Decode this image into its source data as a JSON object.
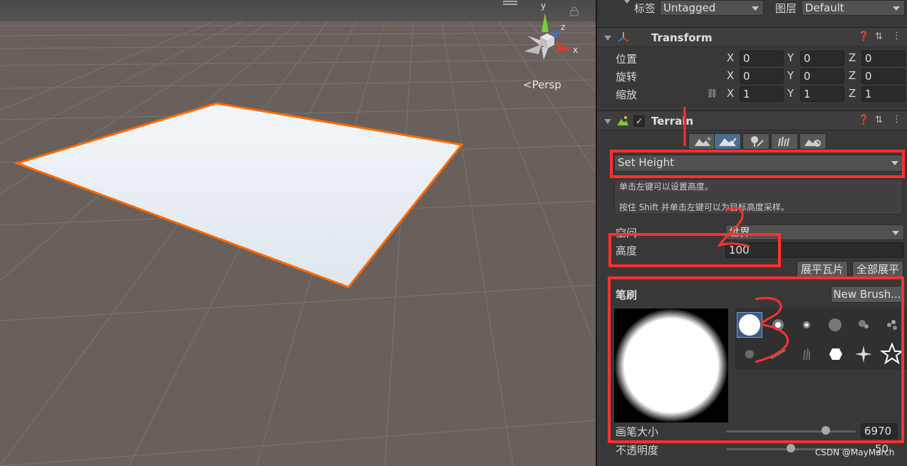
{
  "scene": {
    "view_mode": "<Persp",
    "gizmo_axes": {
      "x": "x",
      "y": "y",
      "z": "z"
    },
    "colors": {
      "ground": "#6a605b",
      "grid": "#807775",
      "sky": "#4a4a4a",
      "plane": "#e8eef4",
      "outline": "#ff6a00"
    }
  },
  "inspector": {
    "tag_label": "标签",
    "tag_value": "Untagged",
    "layer_label": "图层",
    "layer_value": "Default",
    "transform": {
      "title": "Transform",
      "rows": [
        {
          "label": "位置",
          "x": "0",
          "y": "0",
          "z": "0"
        },
        {
          "label": "旋转",
          "x": "0",
          "y": "0",
          "z": "0"
        },
        {
          "label": "缩放",
          "x": "1",
          "y": "1",
          "z": "1"
        }
      ],
      "axis_x": "X",
      "axis_y": "Y",
      "axis_z": "Z"
    },
    "terrain": {
      "title": "Terrain",
      "enabled": true,
      "tool": "Set Height",
      "help_line1": "单击左键可以设置高度。",
      "help_line2": "按住 Shift 并单击左键可以为目标高度采样。",
      "space_label": "空间",
      "space_value": "世界",
      "height_label": "高度",
      "height_value": "100",
      "flatten_tile_button": "展平瓦片",
      "flatten_all_button": "全部展平",
      "brushes_label": "笔刷",
      "new_brush_button": "New Brush...",
      "brush_size_label": "画笔大小",
      "brush_size_value": "6970",
      "brush_size_level": 0.77,
      "opacity_label": "不透明度",
      "opacity_value": "50",
      "opacity_level": 0.5
    },
    "annotations": {
      "color": "#ff3030"
    }
  },
  "watermark": "CSDN @MayMarch"
}
